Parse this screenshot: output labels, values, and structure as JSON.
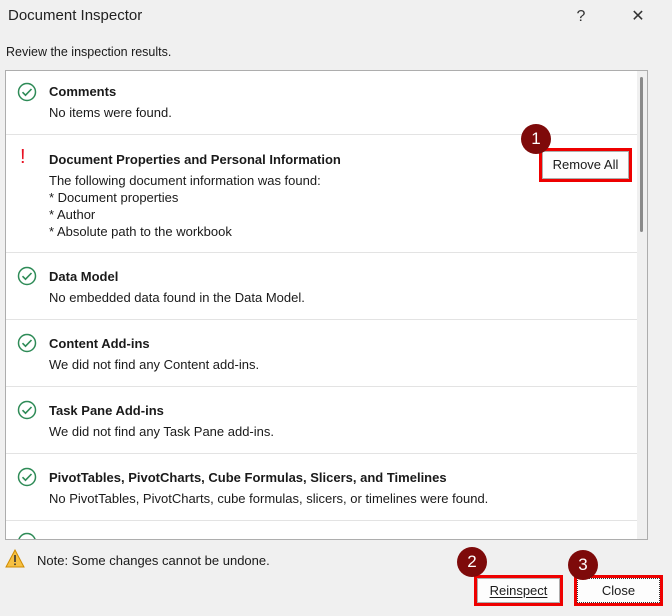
{
  "window": {
    "title": "Document Inspector",
    "help": "?",
    "close": "✕"
  },
  "intro": "Review the inspection results.",
  "results": [
    {
      "status": "ok",
      "title": "Comments",
      "lines": [
        "No items were found."
      ]
    },
    {
      "status": "warning",
      "title": "Document Properties and Personal Information",
      "lines": [
        "The following document information was found:",
        "* Document properties",
        "* Author",
        "* Absolute path to the workbook"
      ],
      "action": "Remove All"
    },
    {
      "status": "ok",
      "title": "Data Model",
      "lines": [
        "No embedded data found in the Data Model."
      ]
    },
    {
      "status": "ok",
      "title": "Content Add-ins",
      "lines": [
        "We did not find any Content add-ins."
      ]
    },
    {
      "status": "ok",
      "title": "Task Pane Add-ins",
      "lines": [
        "We did not find any Task Pane add-ins."
      ]
    },
    {
      "status": "ok",
      "title": "PivotTables, PivotCharts, Cube Formulas, Slicers, and Timelines",
      "lines": [
        "No PivotTables, PivotCharts, cube formulas, slicers, or timelines were found."
      ]
    }
  ],
  "footer": {
    "note": "Note: Some changes cannot be undone.",
    "reinspect": "Reinspect",
    "close": "Close"
  },
  "badges": [
    "1",
    "2",
    "3"
  ],
  "colors": {
    "ok": "#2e8b57",
    "warning": "#e81123",
    "highlight": "#e00000",
    "badge": "#7e0a0a"
  }
}
